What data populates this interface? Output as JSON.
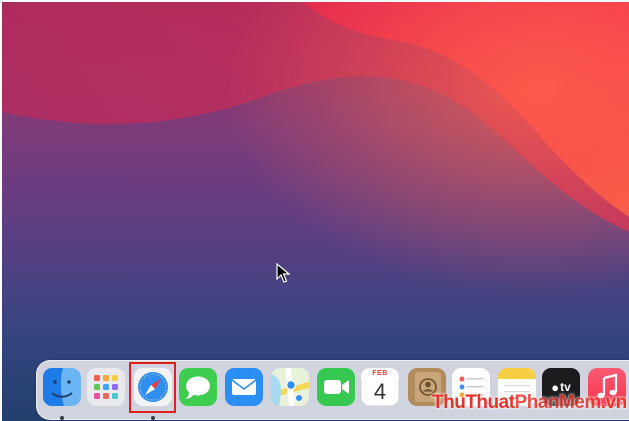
{
  "desktop": {
    "colors": {
      "top_left": "#a0305e",
      "upper_right": "#f3374f",
      "bottom": "#213f6d"
    }
  },
  "cursor": {
    "icon": "arrow-cursor-icon"
  },
  "dock": {
    "items": [
      {
        "name": "Finder",
        "icon": "finder-icon",
        "running": true
      },
      {
        "name": "Launchpad",
        "icon": "launchpad-icon",
        "running": false
      },
      {
        "name": "Safari",
        "icon": "safari-icon",
        "running": true,
        "highlighted": true
      },
      {
        "name": "Messages",
        "icon": "messages-icon",
        "running": false
      },
      {
        "name": "Mail",
        "icon": "mail-icon",
        "running": false
      },
      {
        "name": "Maps",
        "icon": "maps-icon",
        "running": false
      },
      {
        "name": "FaceTime",
        "icon": "facetime-icon",
        "running": false
      },
      {
        "name": "Calendar",
        "icon": "calendar-icon",
        "running": false,
        "month": "FEB",
        "day": "4"
      },
      {
        "name": "Contacts",
        "icon": "contacts-icon",
        "running": false
      },
      {
        "name": "Reminders",
        "icon": "reminders-icon",
        "running": false
      },
      {
        "name": "Notes",
        "icon": "notes-icon",
        "running": false
      },
      {
        "name": "TV",
        "icon": "apple-tv-icon",
        "running": false,
        "label": "tv"
      },
      {
        "name": "Music",
        "icon": "music-icon",
        "running": false
      }
    ],
    "highlight_color": "#e0211b"
  },
  "watermark": {
    "part1": "ThuThuat",
    "part2": "PhanMem",
    "part3": ".vn"
  }
}
